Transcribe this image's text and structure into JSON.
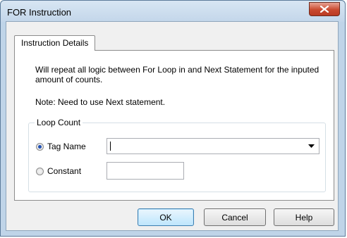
{
  "window": {
    "title": "FOR Instruction",
    "close_icon": "close-icon"
  },
  "tabs": [
    {
      "label": "Instruction Details",
      "selected": true
    }
  ],
  "description": "Will repeat all logic between For Loop in and Next Statement for the inputed amount of counts.",
  "note": "Note: Need to use Next statement.",
  "loop_count": {
    "legend": "Loop Count",
    "options": [
      {
        "label": "Tag Name",
        "selected": true
      },
      {
        "label": "Constant",
        "selected": false
      }
    ],
    "tag_name_value": "",
    "constant_value": ""
  },
  "buttons": {
    "ok": "OK",
    "cancel": "Cancel",
    "help": "Help"
  },
  "colors": {
    "title_bar": "#c9dcef",
    "close_button": "#c9492f",
    "default_button_border": "#3c7fb1",
    "radio_dot": "#1e4fb4"
  }
}
